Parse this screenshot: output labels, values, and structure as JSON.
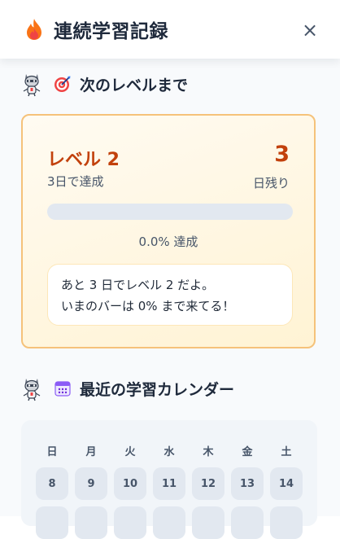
{
  "header": {
    "icon": "flame-icon",
    "title": "連続学習記録",
    "close_icon": "close-icon",
    "close_label": "×"
  },
  "next_level_section": {
    "mascot_icon": "mascot-icon",
    "icon": "target-icon",
    "title": "次のレベルまで"
  },
  "level_card": {
    "level_label": "レベル 2",
    "achieve_text": "3日で達成",
    "days_remaining": "3",
    "days_remaining_label": "日残り",
    "progress_percent": 0,
    "progress_text": "0.0% 達成",
    "message_lines": [
      "あと 3 日でレベル 2 だよ。",
      "いまのバーは 0% まで来てる！"
    ]
  },
  "calendar_section": {
    "mascot_icon": "mascot-icon",
    "icon": "calendar-icon",
    "title": "最近の学習カレンダー",
    "weekdays": [
      "日",
      "月",
      "火",
      "水",
      "木",
      "金",
      "土"
    ],
    "rows": [
      [
        "8",
        "9",
        "10",
        "11",
        "12",
        "13",
        "14"
      ],
      [
        "",
        "",
        "",
        "",
        "",
        "",
        ""
      ]
    ]
  },
  "colors": {
    "accent": "#c2410c",
    "card_border": "#f5c27a",
    "progress_track": "#e2e8f0"
  }
}
